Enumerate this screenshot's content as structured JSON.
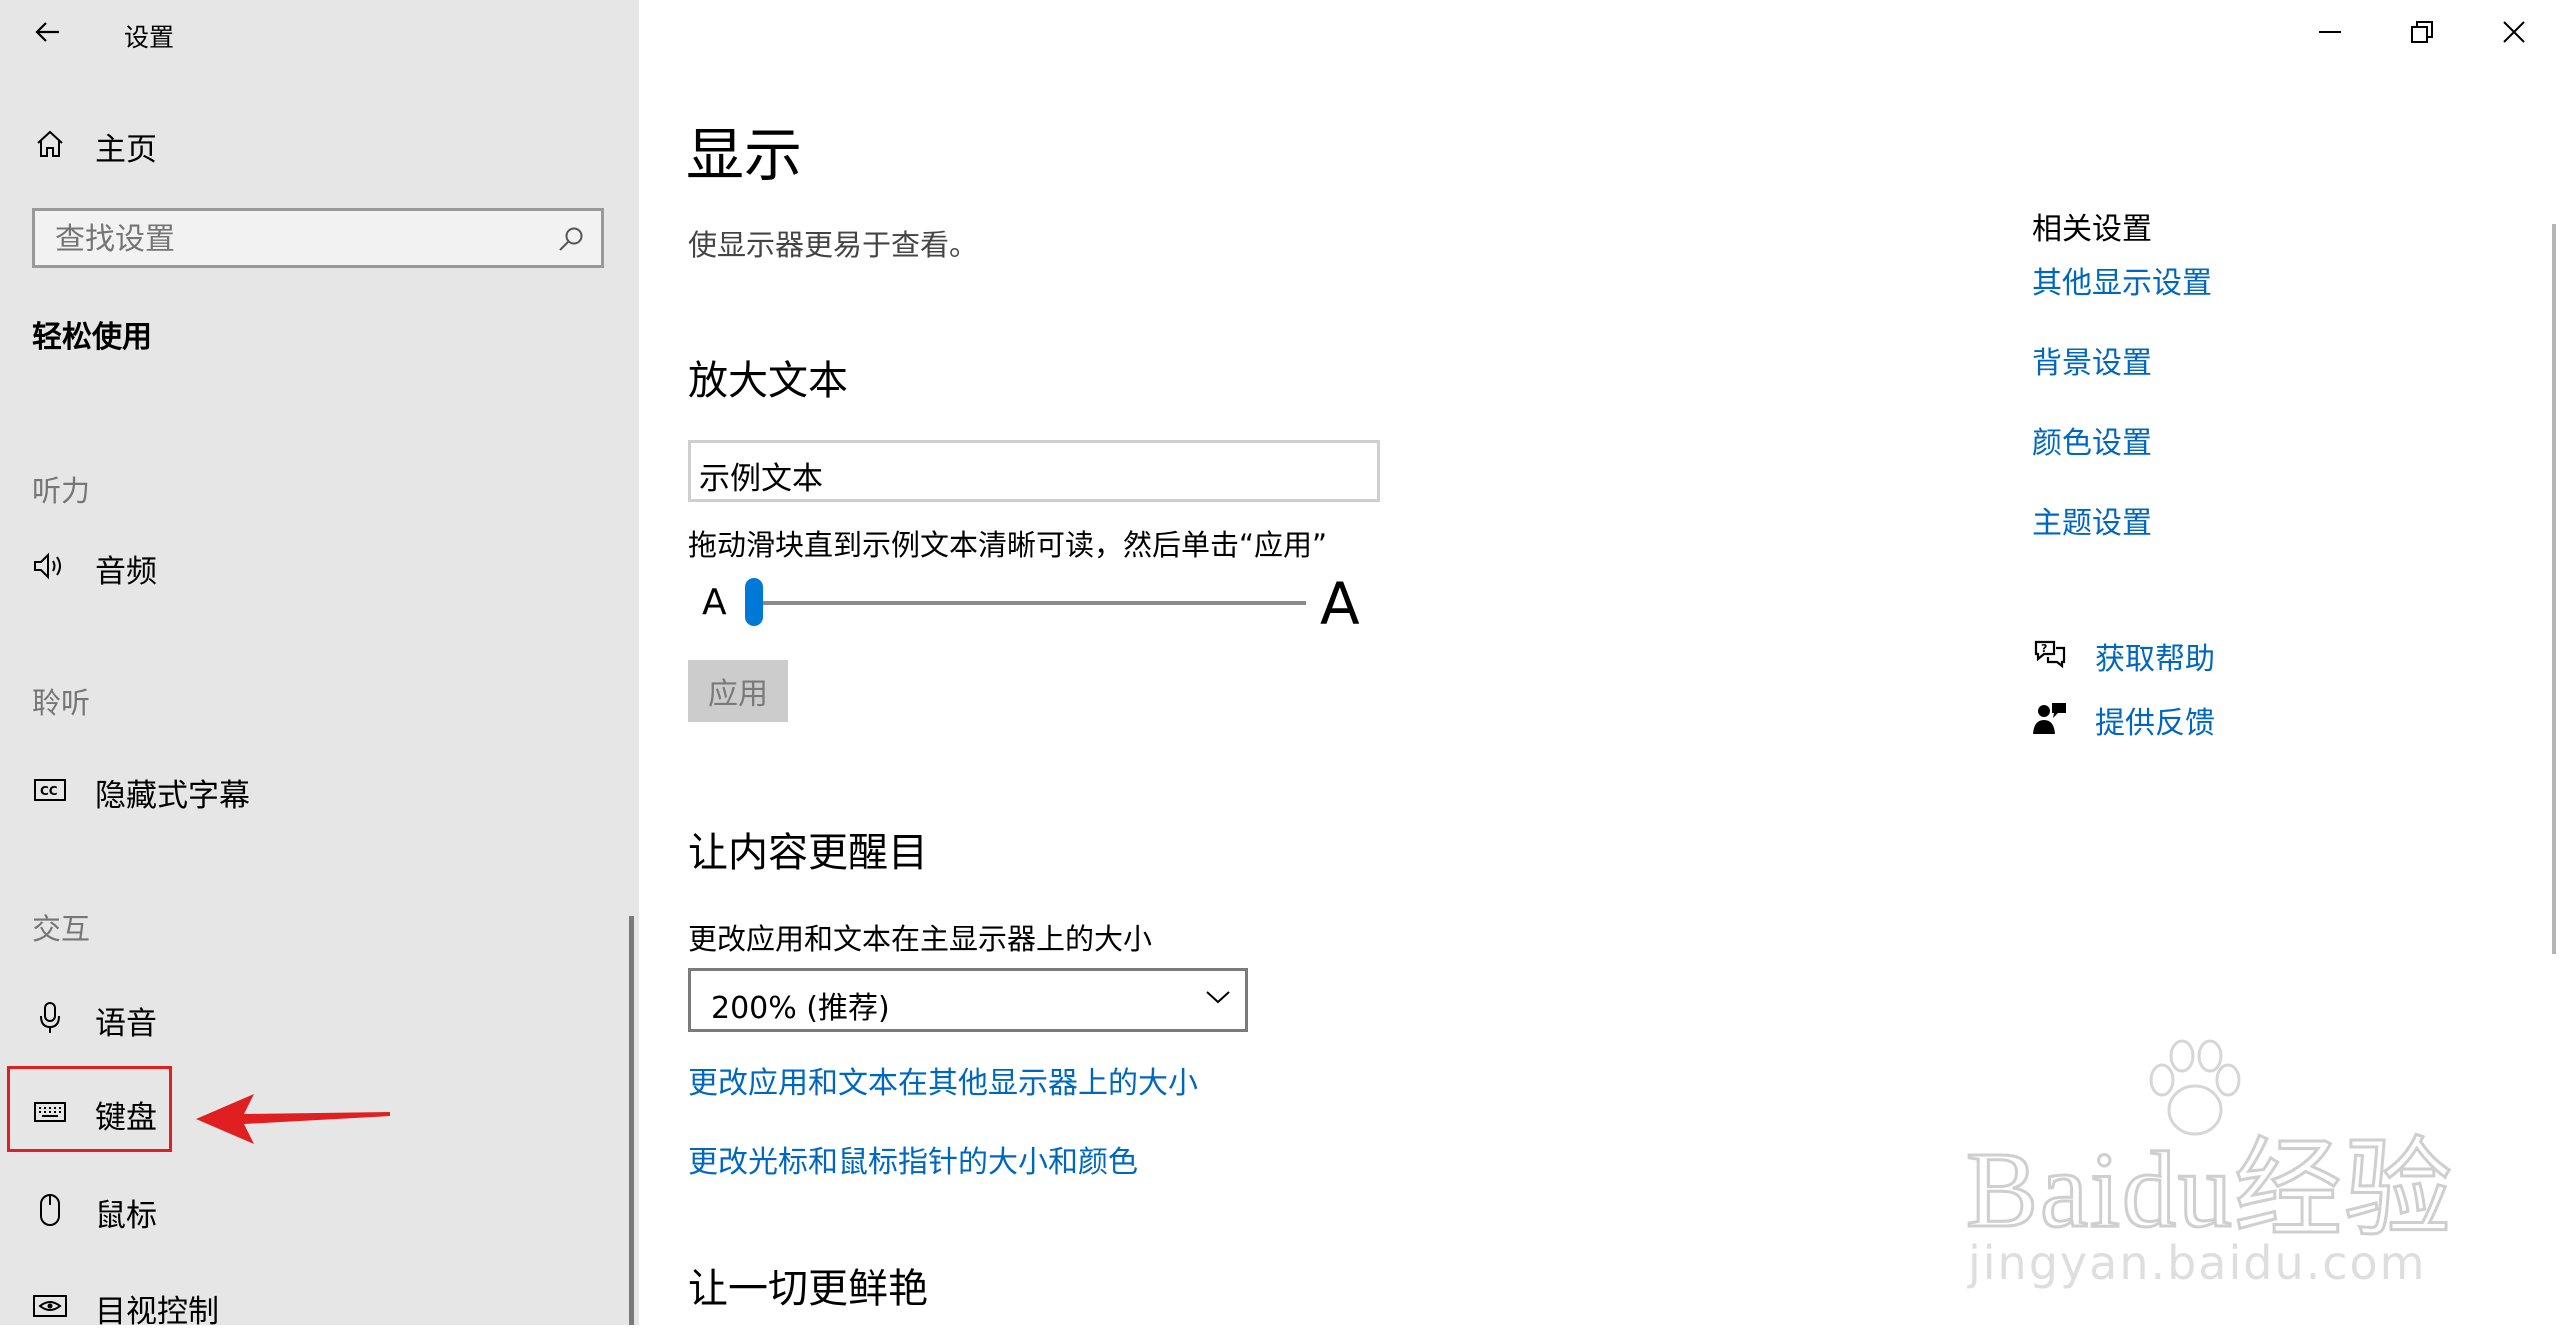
{
  "window": {
    "title": "设置",
    "controls": {
      "minimize": "minimize-icon",
      "restore": "restore-icon",
      "close": "close-icon"
    }
  },
  "sidebar": {
    "home_label": "主页",
    "search_placeholder": "查找设置",
    "category": "轻松使用",
    "groups": [
      {
        "header": "听力",
        "items": [
          {
            "label": "音频",
            "icon": "speaker-icon"
          }
        ]
      },
      {
        "header": "聆听",
        "items": [
          {
            "label": "隐藏式字幕",
            "icon": "closed-caption-icon"
          }
        ]
      },
      {
        "header": "交互",
        "items": [
          {
            "label": "语音",
            "icon": "microphone-icon"
          },
          {
            "label": "键盘",
            "icon": "keyboard-icon"
          },
          {
            "label": "鼠标",
            "icon": "mouse-icon"
          },
          {
            "label": "目视控制",
            "icon": "eye-icon"
          }
        ]
      }
    ]
  },
  "main": {
    "title": "显示",
    "subtitle": "使显示器更易于查看。",
    "sections": {
      "enlarge_text": {
        "heading": "放大文本",
        "sample_text": "示例文本",
        "instruction": "拖动滑块直到示例文本清晰可读，然后单击“应用”",
        "slider_small_label": "A",
        "slider_large_label": "A",
        "slider_value": 0,
        "apply_label": "应用"
      },
      "make_bigger": {
        "heading": "让内容更醒目",
        "size_label": "更改应用和文本在主显示器上的大小",
        "size_value": "200% (推荐)",
        "link_other_displays": "更改应用和文本在其他显示器上的大小",
        "link_cursor": "更改光标和鼠标指针的大小和颜色"
      },
      "brighter": {
        "heading": "让一切更鲜艳"
      }
    }
  },
  "related": {
    "heading": "相关设置",
    "links": [
      "其他显示设置",
      "背景设置",
      "颜色设置",
      "主题设置"
    ],
    "help_label": "获取帮助",
    "feedback_label": "提供反馈"
  },
  "watermark": {
    "brand": "Baidu经验",
    "url": "jingyan.baidu.com"
  },
  "colors": {
    "accent": "#0078d7",
    "link": "#0067c0",
    "sidebar_bg": "#e6e6e6",
    "annotation": "#e02020"
  }
}
